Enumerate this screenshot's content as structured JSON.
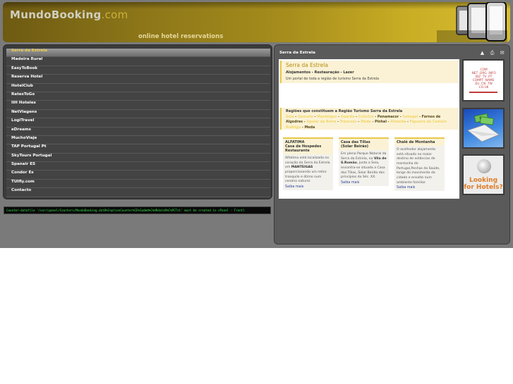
{
  "header": {
    "logo_main": "MundoBooking",
    "logo_suffix": ".com",
    "tagline": "online hotel reservations"
  },
  "nav": {
    "items": [
      {
        "label": "Serra da Estrela",
        "active": true
      },
      {
        "label": "Madeira Rural"
      },
      {
        "label": "EasyToBook"
      },
      {
        "label": "Reserva Hotel"
      },
      {
        "label": "HotelClub"
      },
      {
        "label": "RatesToGo"
      },
      {
        "label": "IIH Hoteles"
      },
      {
        "label": "NetViagens"
      },
      {
        "label": "LogiTravel"
      },
      {
        "label": "eDreams"
      },
      {
        "label": "MuchoViaje"
      },
      {
        "label": "TAP Portugal Pt"
      },
      {
        "label": "SkyTours Portugal"
      },
      {
        "label": "Spanair ES"
      },
      {
        "label": "Condor Es"
      },
      {
        "label": "TUIfly.com"
      },
      {
        "label": "Contacto"
      }
    ]
  },
  "counter_text": "Counter-datafile '/var/cpanel/Counters/MundoBooking.dat8%CeptionCounter%CE%Sadmd%C%HRdatsB%C%PCTxt' must be created in cPanel - Frontl",
  "right": {
    "title": "Serra da Estrela",
    "toolbar_icons": [
      "pdf-icon",
      "print-icon",
      "email-icon"
    ]
  },
  "intro": {
    "title": "Serra da Estrela",
    "subtitle": "Alojamentos - Restauração - Lazer",
    "description": "Um portal de toda a região de turismo Serra da Estrela"
  },
  "regions": {
    "title": "Regiões que constituem a Região Turismo Serra da Estrela",
    "list": [
      {
        "name": "Seia",
        "style": "hl"
      },
      {
        "name": "Gouveia",
        "style": "hl"
      },
      {
        "name": "Manteigas",
        "style": "hl"
      },
      {
        "name": "Guarda",
        "style": "hl"
      },
      {
        "name": "Celorico",
        "style": "hl"
      },
      {
        "name": "Penamacor",
        "style": "dk"
      },
      {
        "name": "Sabugal",
        "style": "hl"
      },
      {
        "name": "Fornos de Algodres",
        "style": "dk"
      },
      {
        "name": "Aguiar da Beira",
        "style": "hl"
      },
      {
        "name": "Trancoso",
        "style": "hl"
      },
      {
        "name": "Meda",
        "style": "hl"
      },
      {
        "name": "Pinhel",
        "style": "dk"
      },
      {
        "name": "Almeida",
        "style": "hl"
      },
      {
        "name": "Figueira de Castelo Rodrigo",
        "style": "hl"
      },
      {
        "name": "Meda",
        "style": "dk"
      }
    ]
  },
  "cards": [
    {
      "title": "ALFATIMA\nCasa de Hospedes Restaurante",
      "text_before": "Alfatima está localizada no coração da Serra da Estrela em ",
      "bold": "MANTEIGAS",
      "text_after": " proporcionando um retiro tranquilo e ótimo num cenário natural.",
      "more": "Saiba mais"
    },
    {
      "title": "Casa das Tílias\n(Solar Beirão)",
      "text_before": "Em pleno Parque Natural da Serra da Estrela, na ",
      "bold": "Vila de S.Romão",
      "text_after": ", junto a Seia, encontra-se situada a Casa das Tílias, Solar Beirão dos princípios do Séc. XX.",
      "more": "Saiba mais"
    },
    {
      "title": "Chalé de Montanha",
      "text_before": "O acolhedor alojamento está situado no maior destino de estâncias de montanha de Portugal,Penhas da Saúde, longe do movimento da cidade e envolto num ambiente familiar.",
      "bold": "",
      "text_after": "",
      "more": "Saiba mais"
    }
  ],
  "banners": {
    "domains": [
      ".COM",
      ".NET .ORG .INFO",
      ".BIZ .TV .PT",
      "COMPT .NAME",
      ".EU .CN .TW",
      ".CO.UK"
    ],
    "hotels_text": "Looking for Hotels?"
  }
}
